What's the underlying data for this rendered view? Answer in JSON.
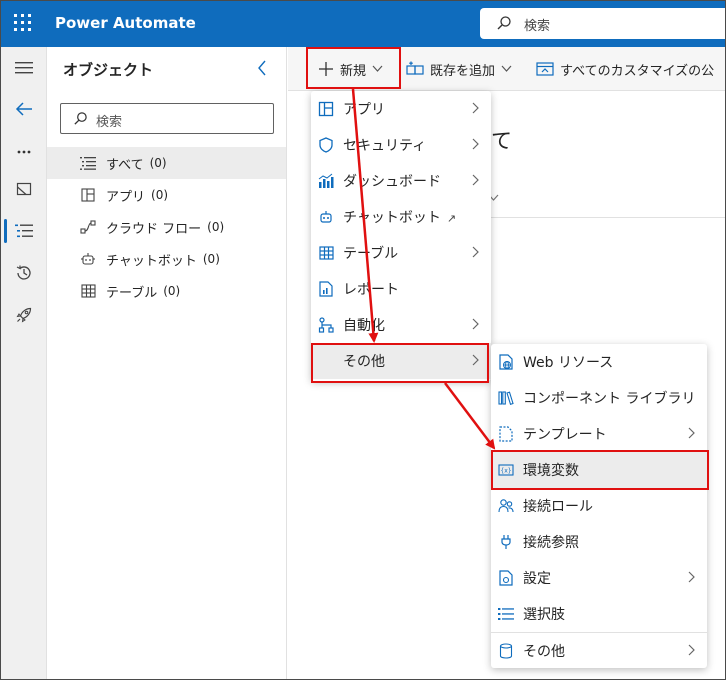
{
  "app": {
    "title": "Power Automate",
    "search_placeholder": "検索"
  },
  "panel": {
    "title": "オブジェクト",
    "search_placeholder": "検索",
    "items": [
      {
        "label": "すべて",
        "count": "(0)",
        "icon": "list-icon"
      },
      {
        "label": "アプリ",
        "count": "(0)",
        "icon": "app-icon"
      },
      {
        "label": "クラウド フロー",
        "count": "(0)",
        "icon": "flow-icon"
      },
      {
        "label": "チャットボット",
        "count": "(0)",
        "icon": "bot-icon"
      },
      {
        "label": "テーブル",
        "count": "(0)",
        "icon": "table-icon"
      }
    ]
  },
  "toolbar": {
    "new_label": "新規",
    "add_existing_label": "既存を追加",
    "publish_label": "すべてのカスタマイズの公"
  },
  "main": {
    "partial_heading": "て"
  },
  "menu1": [
    {
      "label": "アプリ",
      "icon": "app-icon",
      "submenu": true
    },
    {
      "label": "セキュリティ",
      "icon": "shield-icon",
      "submenu": true
    },
    {
      "label": "ダッシュボード",
      "icon": "dashboard-icon",
      "submenu": true
    },
    {
      "label": "チャットボット",
      "icon": "bot-icon",
      "external": true
    },
    {
      "label": "テーブル",
      "icon": "table-icon",
      "submenu": true
    },
    {
      "label": "レポート",
      "icon": "report-icon"
    },
    {
      "label": "自動化",
      "icon": "flow-icon",
      "submenu": true
    },
    {
      "label": "その他",
      "icon": "",
      "submenu": true,
      "highlighted": true
    }
  ],
  "menu2": [
    {
      "label": "Web リソース",
      "icon": "web-resource-icon"
    },
    {
      "label": "コンポーネント ライブラリ",
      "icon": "library-icon"
    },
    {
      "label": "テンプレート",
      "icon": "template-icon",
      "submenu": true
    },
    {
      "label": "環境変数",
      "icon": "variable-icon",
      "highlighted": true
    },
    {
      "label": "接続ロール",
      "icon": "people-icon"
    },
    {
      "label": "接続参照",
      "icon": "plug-icon"
    },
    {
      "label": "設定",
      "icon": "settings-icon",
      "submenu": true
    },
    {
      "label": "選択肢",
      "icon": "choices-icon"
    },
    {
      "label": "その他",
      "icon": "database-icon",
      "submenu": true
    }
  ],
  "colors": {
    "brand": "#0f6cbd",
    "annotation": "#e01010"
  }
}
